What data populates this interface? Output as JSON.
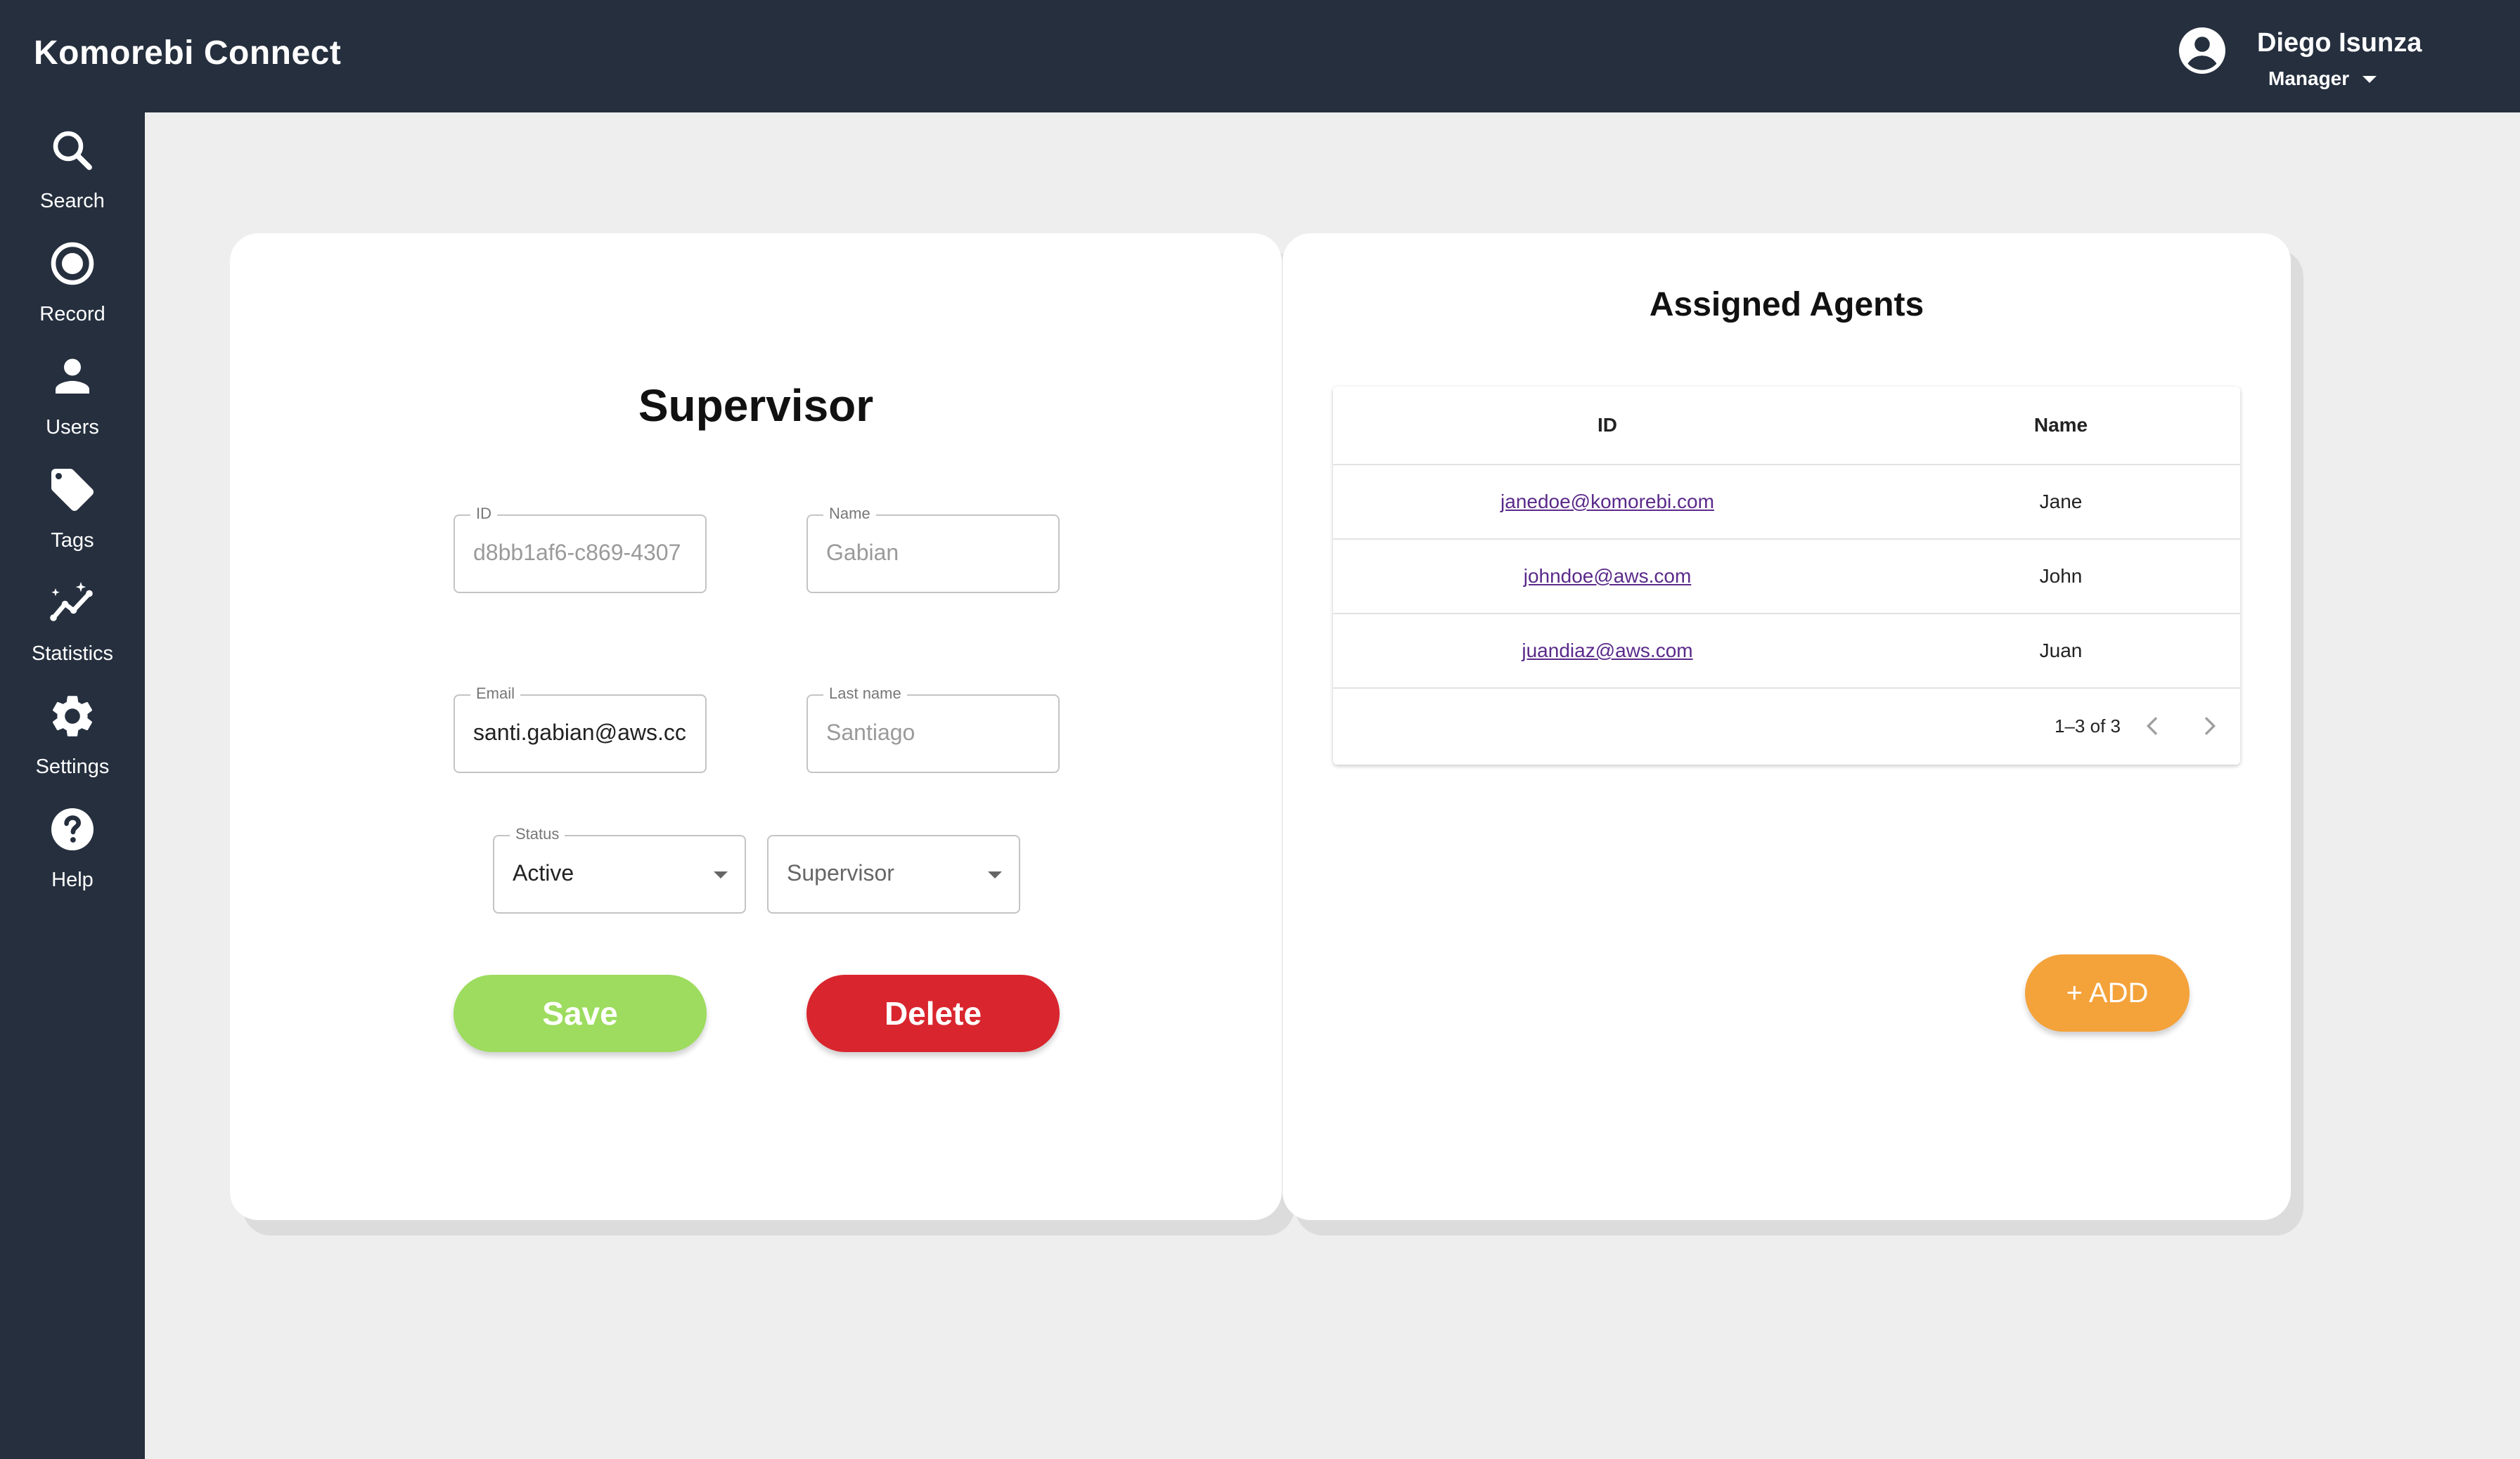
{
  "app": {
    "title": "Komorebi Connect"
  },
  "user": {
    "name": "Diego Isunza",
    "role": "Manager"
  },
  "sidebar": {
    "items": [
      {
        "label": "Search",
        "icon": "search-icon"
      },
      {
        "label": "Record",
        "icon": "record-icon"
      },
      {
        "label": "Users",
        "icon": "person-icon"
      },
      {
        "label": "Tags",
        "icon": "tag-icon"
      },
      {
        "label": "Statistics",
        "icon": "statistics-icon"
      },
      {
        "label": "Settings",
        "icon": "gear-icon"
      },
      {
        "label": "Help",
        "icon": "help-icon"
      }
    ]
  },
  "supervisor": {
    "title": "Supervisor",
    "id_label": "ID",
    "id_value": "d8bb1af6-c869-4307",
    "name_label": "Name",
    "name_value": "Gabian",
    "email_label": "Email",
    "email_value": "santi.gabian@aws.cc",
    "lastname_label": "Last name",
    "lastname_value": "Santiago",
    "status_label": "Status",
    "status_value": "Active",
    "role_value": "Supervisor",
    "save_label": "Save",
    "delete_label": "Delete"
  },
  "agents": {
    "title": "Assigned Agents",
    "columns": [
      "ID",
      "Name"
    ],
    "rows": [
      {
        "id": "janedoe@komorebi.com",
        "name": "Jane"
      },
      {
        "id": "johndoe@aws.com",
        "name": "John"
      },
      {
        "id": "juandiaz@aws.com",
        "name": "Juan"
      }
    ],
    "pagination": "1–3 of 3",
    "add_label": "+ ADD"
  },
  "colors": {
    "topbar": "#252f3e",
    "save": "#9ddc5e",
    "delete": "#d9262e",
    "add": "#f4a23a",
    "link": "#5a2a8a"
  }
}
